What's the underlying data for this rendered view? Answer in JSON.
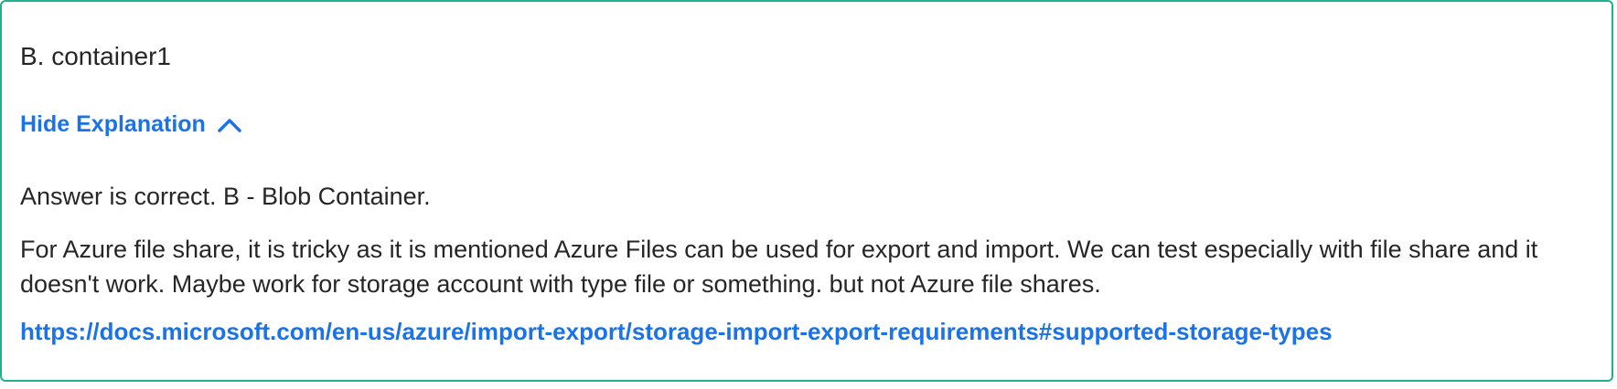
{
  "answer": {
    "option": "B. container1"
  },
  "toggle": {
    "label": "Hide Explanation",
    "icon": "chevron-up-icon"
  },
  "explanation": {
    "summary": "Answer is correct. B - Blob Container.",
    "details": "For Azure file share, it is tricky as it is mentioned Azure Files can be used for export and import. We can test especially with file share and it doesn't work. Maybe work for storage account with type file or something. but not Azure file shares.",
    "link": "https://docs.microsoft.com/en-us/azure/import-export/storage-import-export-requirements#supported-storage-types"
  },
  "colors": {
    "border": "#1cb38c",
    "link": "#1a73e8",
    "text": "#262626"
  }
}
